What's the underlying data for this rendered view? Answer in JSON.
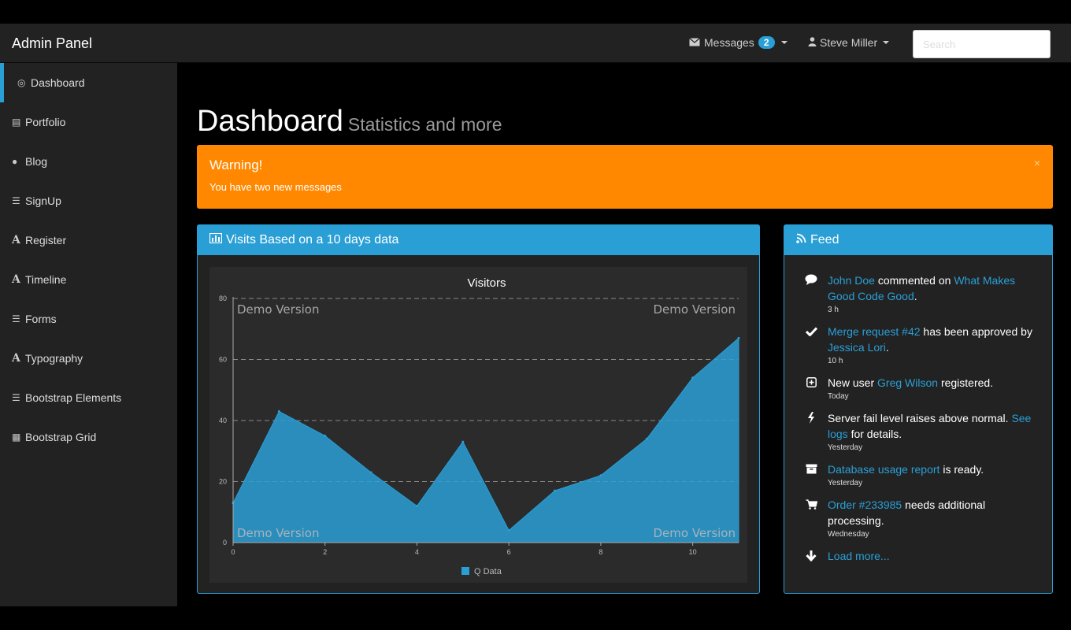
{
  "navbar": {
    "brand": "Admin Panel",
    "messages_label": "Messages",
    "messages_count": "2",
    "user_name": "Steve Miller",
    "search_placeholder": "Search"
  },
  "sidebar": {
    "items": [
      {
        "label": "Dashboard",
        "icon": "dashboard-icon",
        "active": true
      },
      {
        "label": "Portfolio",
        "icon": "portfolio-icon"
      },
      {
        "label": "Blog",
        "icon": "globe-icon"
      },
      {
        "label": "SignUp",
        "icon": "list-icon"
      },
      {
        "label": "Register",
        "icon": "font-icon"
      },
      {
        "label": "Timeline",
        "icon": "font-icon"
      },
      {
        "label": "Forms",
        "icon": "list-icon"
      },
      {
        "label": "Typography",
        "icon": "font-icon"
      },
      {
        "label": "Bootstrap Elements",
        "icon": "list-icon"
      },
      {
        "label": "Bootstrap Grid",
        "icon": "table-icon"
      }
    ]
  },
  "page": {
    "title": "Dashboard",
    "subtitle": "Statistics and more"
  },
  "alert": {
    "title": "Warning!",
    "text": "You have two new messages",
    "close": "×"
  },
  "visits_panel": {
    "title": "Visits Based on a 10 days data",
    "watermark": "Demo Version"
  },
  "chart_data": {
    "type": "area",
    "title": "Visitors",
    "x": [
      0,
      1,
      2,
      3,
      4,
      5,
      6,
      7,
      8,
      9,
      10,
      11
    ],
    "series": [
      {
        "name": "Q Data",
        "values": [
          13,
          43,
          35,
          23,
          12,
          33,
          4,
          17,
          22,
          34,
          54,
          67
        ],
        "color": "#2a9fd6"
      }
    ],
    "xticks": [
      0,
      2,
      4,
      6,
      8,
      10
    ],
    "yticks": [
      0,
      20,
      40,
      60,
      80
    ],
    "xlim": [
      0,
      11
    ],
    "ylim": [
      0,
      80
    ],
    "grid": "horizontal dashed",
    "legend": "bottom-center"
  },
  "feed": {
    "title": "Feed",
    "load_more": "Load more...",
    "items": [
      {
        "icon": "comment-icon",
        "parts": [
          {
            "t": "John Doe",
            "link": true
          },
          {
            "t": " commented on "
          },
          {
            "t": "What Makes Good Code Good",
            "link": true
          },
          {
            "t": "."
          }
        ],
        "time": "3 h"
      },
      {
        "icon": "check-icon",
        "parts": [
          {
            "t": "Merge request #42",
            "link": true
          },
          {
            "t": " has been approved by "
          },
          {
            "t": "Jessica Lori",
            "link": true
          },
          {
            "t": "."
          }
        ],
        "time": "10 h"
      },
      {
        "icon": "plus-square-icon",
        "parts": [
          {
            "t": "New user "
          },
          {
            "t": "Greg Wilson",
            "link": true
          },
          {
            "t": " registered."
          }
        ],
        "time": "Today"
      },
      {
        "icon": "bolt-icon",
        "parts": [
          {
            "t": "Server fail level raises above normal. "
          },
          {
            "t": "See logs",
            "link": true
          },
          {
            "t": " for details."
          }
        ],
        "time": "Yesterday"
      },
      {
        "icon": "archive-icon",
        "parts": [
          {
            "t": "Database usage report",
            "link": true
          },
          {
            "t": " is ready."
          }
        ],
        "time": "Yesterday"
      },
      {
        "icon": "cart-icon",
        "parts": [
          {
            "t": "Order #233985",
            "link": true
          },
          {
            "t": " needs additional processing."
          }
        ],
        "time": "Wednesday"
      }
    ]
  }
}
